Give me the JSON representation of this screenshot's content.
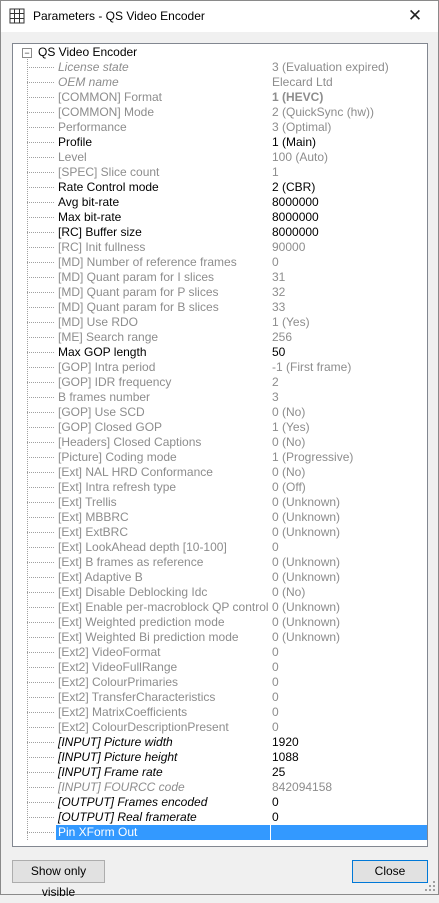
{
  "window": {
    "title": "Parameters - QS Video Encoder",
    "close_glyph": "✕",
    "icon": "grid-table-icon"
  },
  "tree": {
    "root_label": "QS Video Encoder",
    "expander_glyph": "−",
    "rows": [
      {
        "name": "License state",
        "value": "3 (Evaluation expired)",
        "style": "disabled italic"
      },
      {
        "name": "OEM name",
        "value": "Elecard Ltd",
        "style": "disabled italic"
      },
      {
        "name": "[COMMON] Format",
        "value": "1 (HEVC)",
        "style": "disabled bold-val"
      },
      {
        "name": "[COMMON] Mode",
        "value": "2 (QuickSync (hw))",
        "style": "disabled"
      },
      {
        "name": "Performance",
        "value": "3 (Optimal)",
        "style": "disabled"
      },
      {
        "name": "Profile",
        "value": "1 (Main)",
        "style": ""
      },
      {
        "name": "Level",
        "value": "100 (Auto)",
        "style": "disabled"
      },
      {
        "name": "[SPEC] Slice count",
        "value": "1",
        "style": "disabled"
      },
      {
        "name": "Rate Control mode",
        "value": "2 (CBR)",
        "style": ""
      },
      {
        "name": "Avg bit-rate",
        "value": "8000000",
        "style": ""
      },
      {
        "name": "Max bit-rate",
        "value": "8000000",
        "style": ""
      },
      {
        "name": "[RC] Buffer size",
        "value": "8000000",
        "style": ""
      },
      {
        "name": "[RC] Init fullness",
        "value": "90000",
        "style": "disabled"
      },
      {
        "name": "[MD] Number of reference frames",
        "value": "0",
        "style": "disabled"
      },
      {
        "name": "[MD] Quant param for I slices",
        "value": "31",
        "style": "disabled"
      },
      {
        "name": "[MD] Quant param for P slices",
        "value": "32",
        "style": "disabled"
      },
      {
        "name": "[MD] Quant param for B slices",
        "value": "33",
        "style": "disabled"
      },
      {
        "name": "[MD] Use RDO",
        "value": "1 (Yes)",
        "style": "disabled"
      },
      {
        "name": "[ME] Search range",
        "value": "256",
        "style": "disabled"
      },
      {
        "name": "Max GOP length",
        "value": "50",
        "style": ""
      },
      {
        "name": "[GOP] Intra period",
        "value": "-1 (First frame)",
        "style": "disabled"
      },
      {
        "name": "[GOP] IDR frequency",
        "value": "2",
        "style": "disabled"
      },
      {
        "name": "B frames number",
        "value": "3",
        "style": "disabled"
      },
      {
        "name": "[GOP] Use SCD",
        "value": "0 (No)",
        "style": "disabled"
      },
      {
        "name": "[GOP] Closed GOP",
        "value": "1 (Yes)",
        "style": "disabled"
      },
      {
        "name": "[Headers] Closed Captions",
        "value": "0 (No)",
        "style": "disabled"
      },
      {
        "name": "[Picture] Coding mode",
        "value": "1 (Progressive)",
        "style": "disabled"
      },
      {
        "name": "[Ext] NAL HRD Conformance",
        "value": "0 (No)",
        "style": "disabled"
      },
      {
        "name": "[Ext] Intra refresh type",
        "value": "0 (Off)",
        "style": "disabled"
      },
      {
        "name": "[Ext] Trellis",
        "value": "0 (Unknown)",
        "style": "disabled"
      },
      {
        "name": "[Ext] MBBRC",
        "value": "0 (Unknown)",
        "style": "disabled"
      },
      {
        "name": "[Ext] ExtBRC",
        "value": "0 (Unknown)",
        "style": "disabled"
      },
      {
        "name": "[Ext] LookAhead depth [10-100]",
        "value": "0",
        "style": "disabled"
      },
      {
        "name": "[Ext] B frames as reference",
        "value": "0 (Unknown)",
        "style": "disabled"
      },
      {
        "name": "[Ext] Adaptive B",
        "value": "0 (Unknown)",
        "style": "disabled"
      },
      {
        "name": "[Ext] Disable Deblocking Idc",
        "value": "0 (No)",
        "style": "disabled"
      },
      {
        "name": "[Ext] Enable per-macroblock QP control",
        "value": "0 (Unknown)",
        "style": "disabled"
      },
      {
        "name": "[Ext] Weighted prediction mode",
        "value": "0 (Unknown)",
        "style": "disabled"
      },
      {
        "name": "[Ext] Weighted Bi prediction mode",
        "value": "0 (Unknown)",
        "style": "disabled"
      },
      {
        "name": "[Ext2] VideoFormat",
        "value": "0",
        "style": "disabled"
      },
      {
        "name": "[Ext2] VideoFullRange",
        "value": "0",
        "style": "disabled"
      },
      {
        "name": "[Ext2] ColourPrimaries",
        "value": "0",
        "style": "disabled"
      },
      {
        "name": "[Ext2] TransferCharacteristics",
        "value": "0",
        "style": "disabled"
      },
      {
        "name": "[Ext2] MatrixCoefficients",
        "value": "0",
        "style": "disabled"
      },
      {
        "name": "[Ext2] ColourDescriptionPresent",
        "value": "0",
        "style": "disabled"
      },
      {
        "name": "[INPUT] Picture width",
        "value": "1920",
        "style": "italic"
      },
      {
        "name": "[INPUT] Picture height",
        "value": "1088",
        "style": "italic"
      },
      {
        "name": "[INPUT] Frame rate",
        "value": "25",
        "style": "italic"
      },
      {
        "name": "[INPUT] FOURCC code",
        "value": "842094158",
        "style": "disabled italic"
      },
      {
        "name": "[OUTPUT] Frames encoded",
        "value": "0",
        "style": "italic"
      },
      {
        "name": "[OUTPUT] Real framerate",
        "value": "0",
        "style": "italic"
      },
      {
        "name": "Pin XForm Out",
        "value": "",
        "style": "selected"
      }
    ]
  },
  "buttons": {
    "show_visible": "Show only visible",
    "close": "Close"
  },
  "colors": {
    "selection": "#3399ff",
    "disabled_text": "#8d8d8d",
    "default_button_border": "#0078d7"
  }
}
